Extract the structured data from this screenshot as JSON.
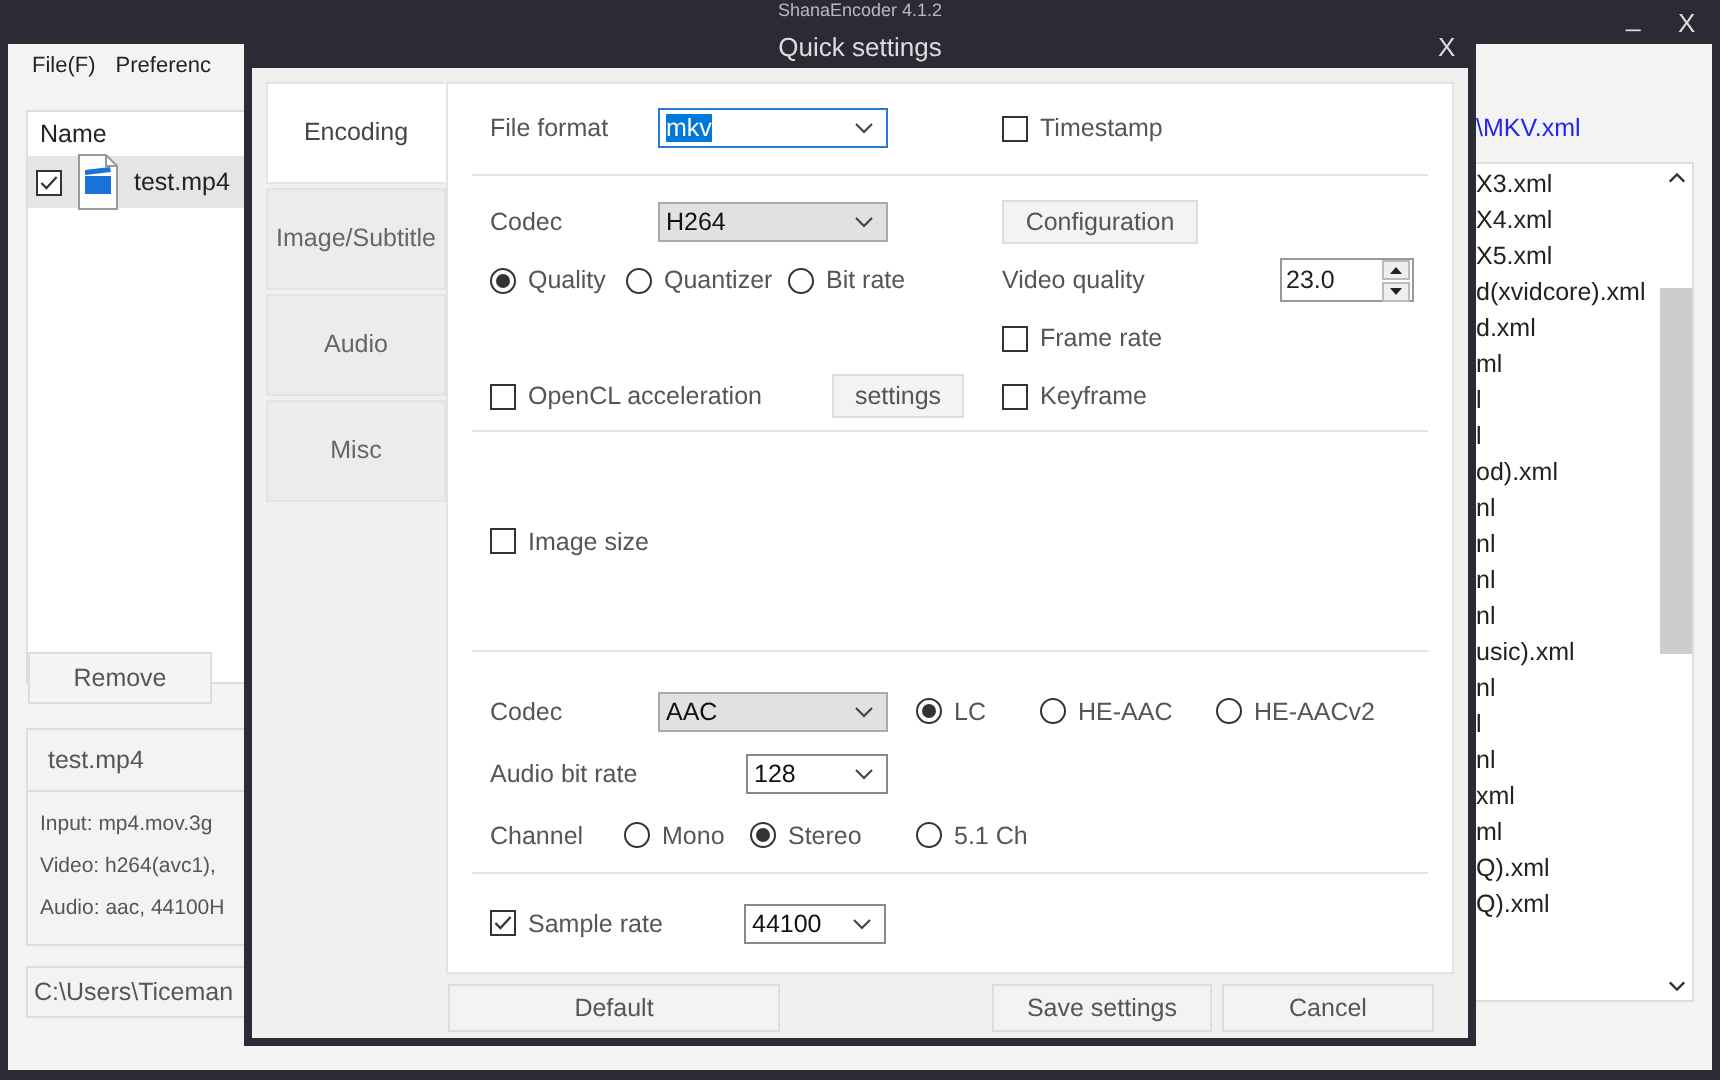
{
  "main_window": {
    "title": "ShanaEncoder 4.1.2",
    "controls": [
      "_",
      "X"
    ],
    "menu": [
      "File(F)",
      "Preferenc"
    ],
    "file_list": {
      "column_1": "Name",
      "rows": [
        {
          "name": "test.mp4",
          "checked": true,
          "selected": true
        }
      ]
    },
    "remove_button": "Remove",
    "file_info": {
      "title": "test.mp4",
      "lines": [
        "Input: mp4.mov.3g",
        "Video: h264(avc1),",
        "Audio: aac, 44100H"
      ]
    },
    "output_path": "C:\\Users\\Ticeman",
    "preset_path": "\\MKV.xml",
    "preset_list": [
      "X3.xml",
      "X4.xml",
      "X5.xml",
      "d(xvidcore).xml",
      "d.xml",
      "ml",
      "l",
      "l",
      "od).xml",
      "nl",
      "nl",
      "nl",
      "nl",
      "usic).xml",
      "nl",
      "l",
      "nl",
      "xml",
      "ml",
      "Q).xml",
      "Q).xml"
    ]
  },
  "dialog": {
    "title": "Quick settings",
    "close": "X",
    "tabs": [
      {
        "label": "Encoding",
        "selected": true
      },
      {
        "label": "Image/Subtitle",
        "selected": false
      },
      {
        "label": "Audio",
        "selected": false
      },
      {
        "label": "Misc",
        "selected": false
      }
    ],
    "file_format": {
      "label": "File format",
      "value": "mkv",
      "kind": "dropdown",
      "focused": true
    },
    "timestamp": {
      "label": "Timestamp",
      "checked": false
    },
    "video_codec": {
      "label": "Codec",
      "value": "H264",
      "kind": "dropdown",
      "focused": false
    },
    "configuration_button": "Configuration",
    "rate_modes": [
      {
        "label": "Quality",
        "selected": true
      },
      {
        "label": "Quantizer",
        "selected": false
      },
      {
        "label": "Bit rate",
        "selected": false
      }
    ],
    "video_quality": {
      "label": "Video quality",
      "value": "23.0"
    },
    "frame_rate": {
      "label": "Frame rate",
      "checked": false
    },
    "opencl": {
      "label": "OpenCL acceleration",
      "checked": false
    },
    "opencl_settings_button": "settings",
    "keyframe": {
      "label": "Keyframe",
      "checked": false
    },
    "image_size": {
      "label": "Image size",
      "checked": false
    },
    "audio_codec": {
      "label": "Codec",
      "value": "AAC",
      "kind": "dropdown",
      "focused": false
    },
    "aac_profiles": [
      {
        "label": "LC",
        "selected": true
      },
      {
        "label": "HE-AAC",
        "selected": false
      },
      {
        "label": "HE-AACv2",
        "selected": false
      }
    ],
    "audio_bit_rate": {
      "label": "Audio bit rate",
      "value": "128",
      "kind": "combo",
      "focused": false
    },
    "channel": {
      "label": "Channel",
      "options": [
        {
          "label": "Mono",
          "selected": false
        },
        {
          "label": "Stereo",
          "selected": true
        },
        {
          "label": "5.1 Ch",
          "selected": false
        }
      ]
    },
    "sample_rate": {
      "label": "Sample rate",
      "checked": true,
      "value": "44100",
      "kind": "combo",
      "focused": false
    },
    "buttons": {
      "default": "Default",
      "save": "Save settings",
      "cancel": "Cancel"
    }
  }
}
